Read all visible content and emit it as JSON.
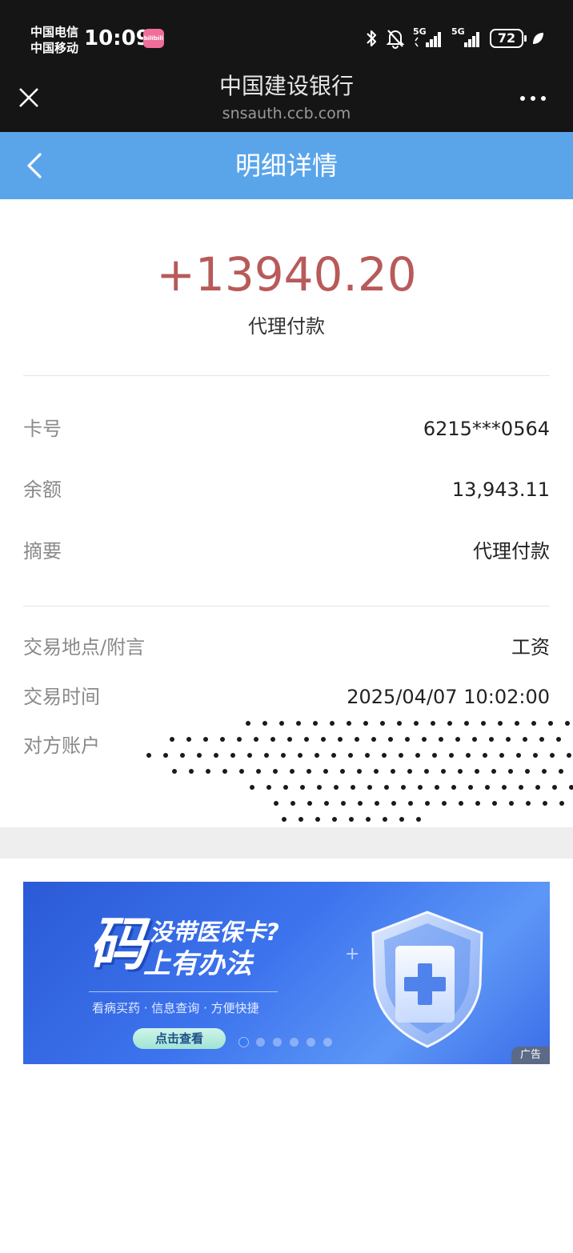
{
  "status_bar": {
    "carrier_1": "中国电信",
    "carrier_2": "中国移动",
    "time": "10:09",
    "app_badge": "bilibili",
    "network_1": "5G",
    "network_2": "5G",
    "battery": "72"
  },
  "browser": {
    "site_title": "中国建设银行",
    "site_url": "snsauth.ccb.com"
  },
  "nav": {
    "title": "明细详情"
  },
  "transaction": {
    "amount": "+13940.20",
    "type": "代理付款",
    "amount_color": "#b85a5a"
  },
  "details": [
    {
      "label": "卡号",
      "value": "6215***0564"
    },
    {
      "label": "余额",
      "value": "13,943.11"
    },
    {
      "label": "摘要",
      "value": "代理付款"
    }
  ],
  "details_2": [
    {
      "label": "交易地点/附言",
      "value": "工资"
    },
    {
      "label": "交易时间",
      "value": "2025/04/07 10:02:00"
    },
    {
      "label": "对方账户",
      "value": ""
    }
  ],
  "ad": {
    "big_char": "码",
    "line1": "没带医保卡?",
    "line2": "上有办法",
    "tagline": "看病买药 · 信息查询 · 方便快捷",
    "button": "点击查看",
    "label": "广告",
    "slides": 6,
    "active_slide": 1
  },
  "colors": {
    "navbar": "#5aa5ea",
    "statusbar": "#151515"
  }
}
